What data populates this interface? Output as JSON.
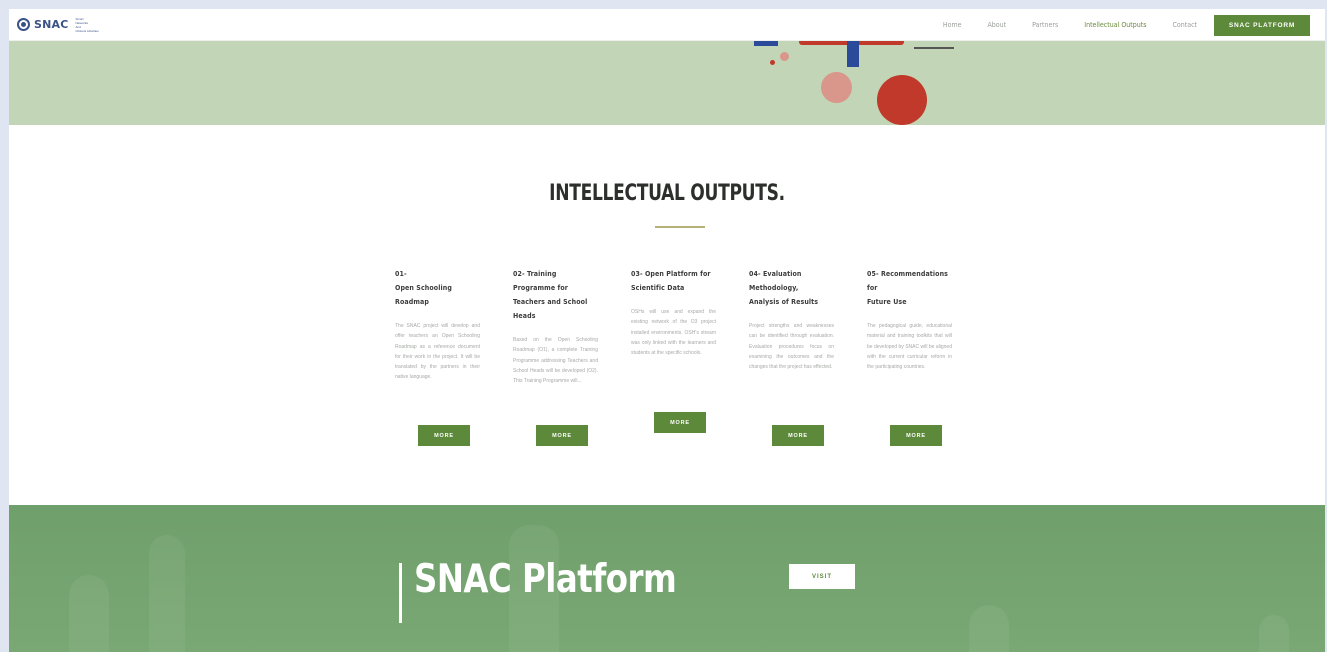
{
  "brand": {
    "name": "SNAC",
    "tagline": [
      "Smart",
      "Networks",
      "And",
      "Citizens Activities"
    ]
  },
  "nav": {
    "items": [
      "Home",
      "About",
      "Partners",
      "Intellectual Outputs",
      "Contact"
    ],
    "active": "Intellectual Outputs",
    "platform_button": "SNAC PLATFORM"
  },
  "section": {
    "title": "INTELLECTUAL OUTPUTS."
  },
  "outputs": [
    {
      "heading_line1": "01-",
      "heading_line2": "Open Schooling Roadmap",
      "body": "The SNAC project will develop and offer teachers an Open Schooling Roadmap as a reference document for their work in the project. It will be translated by the partners in their native language.",
      "button": "MORE"
    },
    {
      "heading_line1": "02- Training Programme for",
      "heading_line2": "Teachers and School Heads",
      "body": "Based on the Open Schooling Roadmap (O1), a complete Training Programme addressing Teachers and School Heads will be developed (O2). This Training Programme will...",
      "button": "MORE"
    },
    {
      "heading_line1": "03- Open Platform for",
      "heading_line2": "Scientific Data",
      "body": "OSHs will use and expand the existing network of the O3 project installed environments. OSH's stream was only linked with the learners and students at the specific schools.",
      "button": "MORE"
    },
    {
      "heading_line1": "04- Evaluation Methodology,",
      "heading_line2": "Analysis of Results",
      "body": "Project strengths and weaknesses can be identified through evaluation. Evaluation procedures focus on examining the outcomes and the changes that the project has effected.",
      "button": "MORE"
    },
    {
      "heading_line1": "05- Recommendations for",
      "heading_line2": "Future Use",
      "body": "The pedagogical guide, educational material and training toolkits that will be developed by SNAC will be aligned with the current curricular reform in the participating countries.",
      "button": "MORE"
    }
  ],
  "platform_band": {
    "title": "SNAC Platform",
    "button": "VISIT"
  },
  "colors": {
    "accent_green": "#5d8a3a",
    "hero_green": "#c2d5b7",
    "band_green": "#74a370",
    "deco_red": "#c0392b",
    "deco_blue": "#2c4a9a",
    "deco_pink": "#d9968a"
  }
}
